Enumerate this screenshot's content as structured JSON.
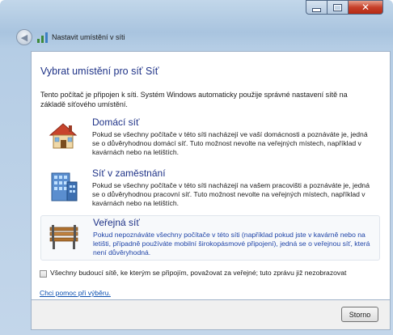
{
  "window": {
    "title": "Nastavit umístění v síti",
    "minimize_glyph": "—",
    "maximize_glyph": "□",
    "close_glyph": "✕"
  },
  "icons": {
    "back": "back-arrow-icon",
    "network": "network-signal-icon",
    "home": "home-house-icon",
    "work": "office-building-icon",
    "public": "park-bench-icon"
  },
  "page": {
    "heading": "Vybrat umístění pro síť Síť",
    "description": "Tento počítač je připojen k síti. Systém Windows automaticky použije správné nastavení sítě na základě síťového umístění."
  },
  "options": [
    {
      "title": "Domácí síť",
      "description": "Pokud se všechny počítače v této síti nacházejí ve vaší domácnosti a poznáváte je, jedná se o důvěryhodnou domácí síť. Tuto možnost nevolte na veřejných místech, například v kavárnách nebo na letištích.",
      "selected": false
    },
    {
      "title": "Síť v zaměstnání",
      "description": "Pokud se všechny počítače v této síti nacházejí na vašem pracovišti a poznáváte je, jedná se o důvěryhodnou pracovní síť. Tuto možnost nevolte na veřejných místech, například v kavárnách nebo na letištích.",
      "selected": false
    },
    {
      "title": "Veřejná síť",
      "description": "Pokud nepoznáváte všechny počítače v této síti (například pokud jste v kavárně nebo na letišti, případně používáte mobilní širokopásmové připojení), jedná se o veřejnou síť, která není důvěryhodná.",
      "selected": true
    }
  ],
  "checkbox": {
    "label": "Všechny budoucí sítě, ke kterým se připojím, považovat za veřejné; tuto zprávu již nezobrazovat",
    "checked": false
  },
  "help_link": "Chci pomoc při výběru.",
  "footer": {
    "cancel_label": "Storno"
  },
  "colors": {
    "link": "#1e3287",
    "selected_text": "#2045a8",
    "hyperlink": "#0a4fb0"
  }
}
